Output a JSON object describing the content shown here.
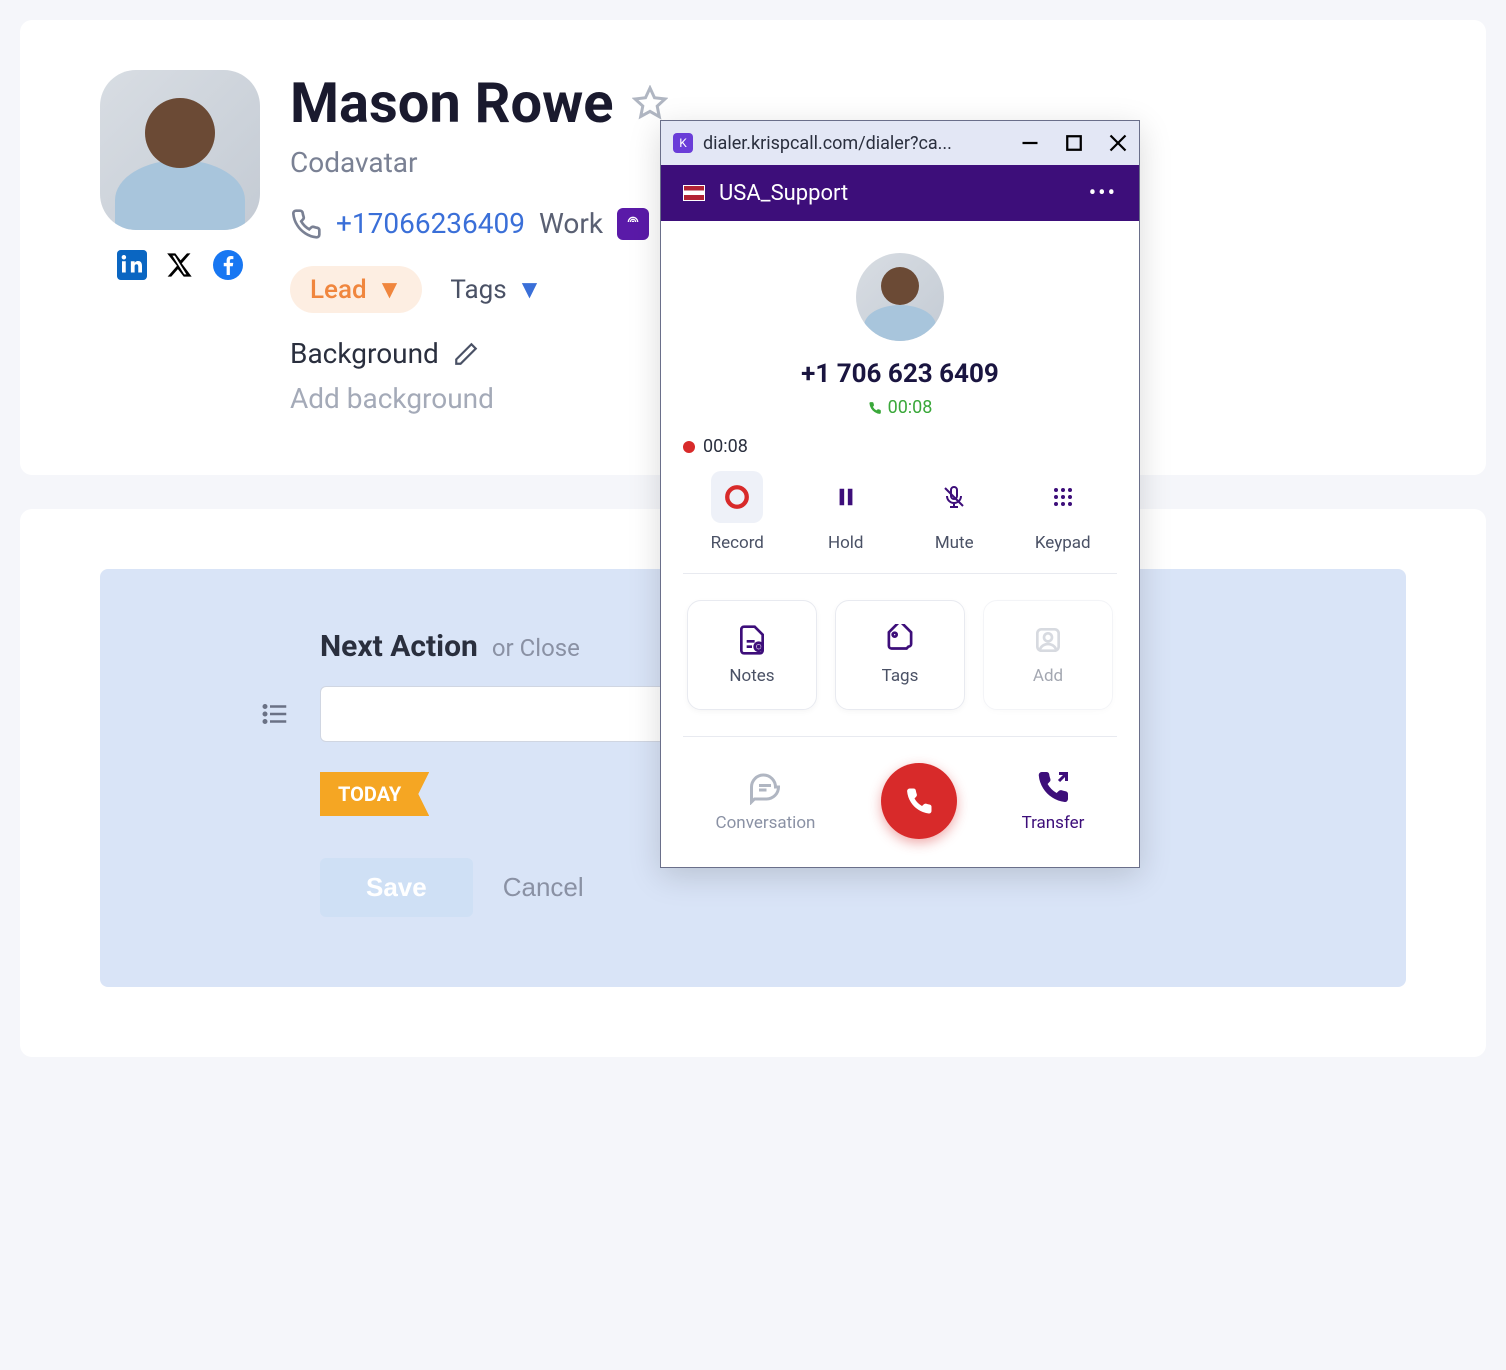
{
  "contact": {
    "name": "Mason Rowe",
    "company": "Codavatar",
    "phone": "+17066236409",
    "phone_label": "Work",
    "status": "Lead",
    "tags_label": "Tags",
    "background_label": "Background",
    "background_placeholder": "Add background"
  },
  "next_action": {
    "title": "Next Action",
    "close": "or Close",
    "today": "TODAY",
    "save": "Save",
    "cancel": "Cancel"
  },
  "dialer": {
    "url": "dialer.krispcall.com/dialer?ca...",
    "line": "USA_Support",
    "phone_display": "+1 706 623 6409",
    "call_timer": "00:08",
    "rec_timer": "00:08",
    "controls": {
      "record": "Record",
      "hold": "Hold",
      "mute": "Mute",
      "keypad": "Keypad"
    },
    "tiles": {
      "notes": "Notes",
      "tags": "Tags",
      "add": "Add"
    },
    "bottom": {
      "conversation": "Conversation",
      "transfer": "Transfer"
    }
  }
}
